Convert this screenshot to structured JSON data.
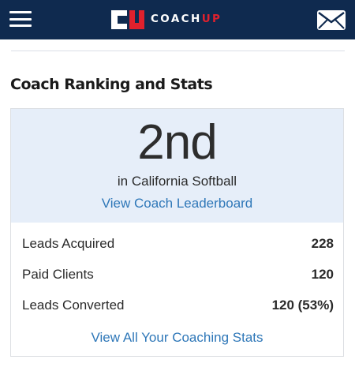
{
  "header": {
    "logo_text_coach": "COACH",
    "logo_text_up": "UP",
    "menu_icon": "hamburger-menu-icon",
    "mail_icon": "envelope-icon",
    "colors": {
      "background": "#0f2a4f",
      "accent_red": "#e0212d"
    }
  },
  "section": {
    "title": "Coach Ranking and Stats"
  },
  "ranking": {
    "rank": "2nd",
    "context": "in California Softball",
    "leaderboard_link": "View Coach Leaderboard"
  },
  "stats": {
    "rows": [
      {
        "label": "Leads Acquired",
        "value": "228"
      },
      {
        "label": "Paid Clients",
        "value": "120"
      },
      {
        "label": "Leads Converted",
        "value": "120 (53%)"
      }
    ],
    "view_all_link": "View All Your Coaching Stats"
  },
  "colors": {
    "link": "#2e77b8",
    "hero_background": "#e6eef9"
  }
}
